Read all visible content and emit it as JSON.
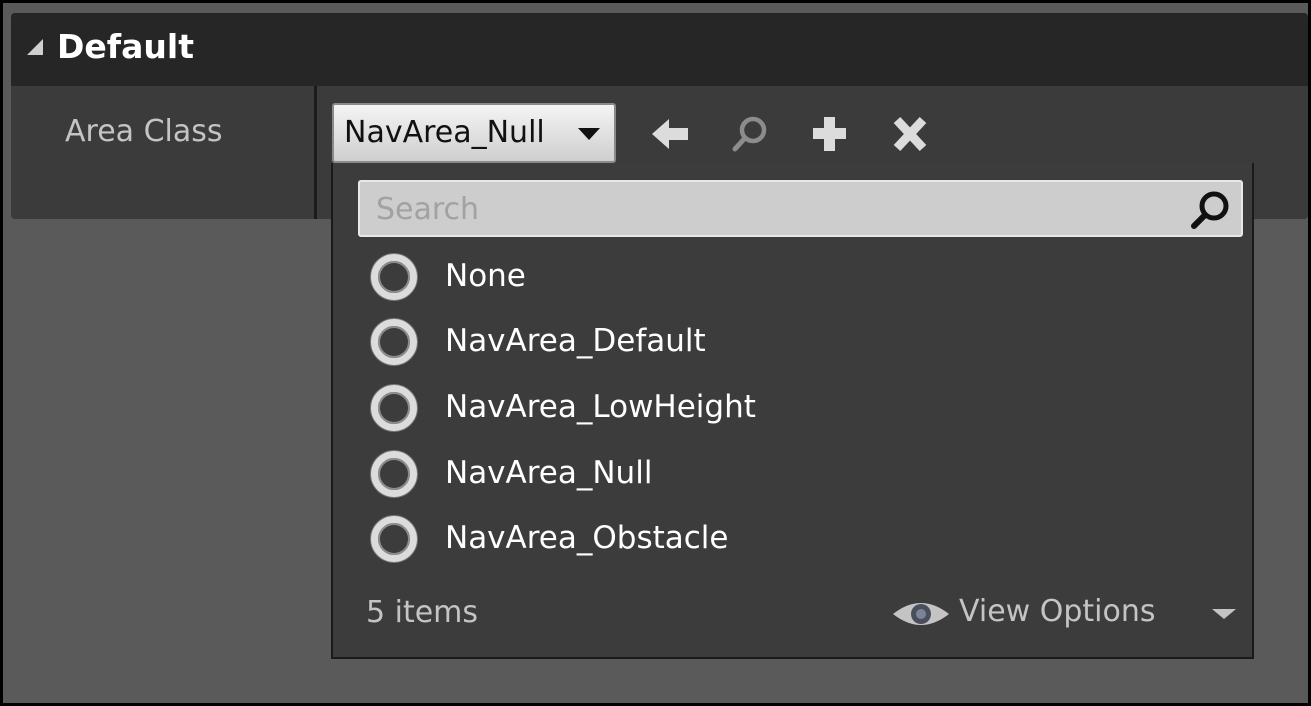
{
  "category": {
    "title": "Default"
  },
  "property": {
    "label": "Area Class",
    "value": "NavArea_Null"
  },
  "toolbar": {
    "icons": [
      "use-selected-arrow-icon",
      "browse-search-icon",
      "add-plus-icon",
      "clear-x-icon"
    ]
  },
  "picker": {
    "search_placeholder": "Search",
    "search_value": "",
    "items": [
      {
        "label": "None"
      },
      {
        "label": "NavArea_Default"
      },
      {
        "label": "NavArea_LowHeight"
      },
      {
        "label": "NavArea_Null"
      },
      {
        "label": "NavArea_Obstacle"
      }
    ],
    "count_label": "5 items",
    "view_options_label": "View Options"
  },
  "colors": {
    "background": "#5a5a5a",
    "panel": "#3b3b3b",
    "header": "#262626",
    "dropdown": "#3c3c3c",
    "text": "#ffffff",
    "muted_text": "#c4c4c4"
  }
}
